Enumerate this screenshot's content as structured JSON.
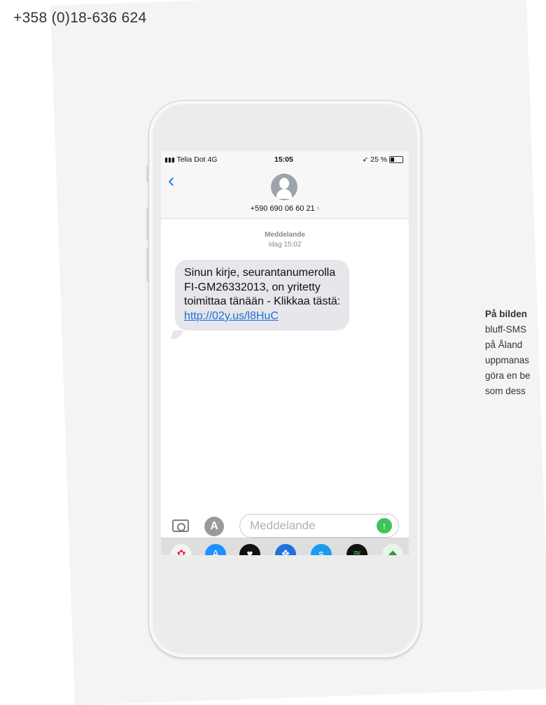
{
  "header": {
    "phone": "+358 (0)18-636 624"
  },
  "caption": {
    "lines": [
      "På bilden",
      "bluff-SMS",
      "på Åland",
      "uppmanas",
      "göra en be",
      "som dess"
    ]
  },
  "phone_ui": {
    "status": {
      "carrier": "Telia Dot  4G",
      "time": "15:05",
      "battery": "25 %"
    },
    "contact": "+590 690 06 60 21",
    "meta": {
      "label": "Meddelande",
      "time": "idag 15:02"
    },
    "message": {
      "text": "Sinun kirje, seurantanumerolla FI-GM26332013, on yritetty toimittaa tänään - Klikkaa tästä: ",
      "link": "http://02y.us/l8HuC"
    },
    "input_placeholder": "Meddelande",
    "dock_icons": [
      "photos-icon",
      "appstore-icon",
      "heart-app-icon",
      "dropbox-icon",
      "shazam-icon",
      "spotify-icon",
      "maps-icon"
    ]
  },
  "colors": {
    "link": "#1b6fd8",
    "back": "#1b7cf2",
    "send": "#3fc35a",
    "bubble": "#e6e6eb"
  }
}
